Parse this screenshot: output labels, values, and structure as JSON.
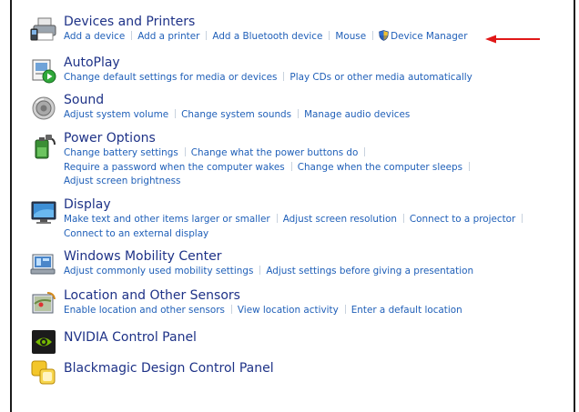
{
  "categories": [
    {
      "title": "Devices and Printers",
      "icon": "devices-printers-icon",
      "links": [
        [
          "Add a device",
          "Add a printer",
          "Add a Bluetooth device",
          "Mouse",
          "Device Manager"
        ]
      ]
    },
    {
      "title": "AutoPlay",
      "icon": "autoplay-icon",
      "links": [
        [
          "Change default settings for media or devices",
          "Play CDs or other media automatically"
        ]
      ]
    },
    {
      "title": "Sound",
      "icon": "speaker-icon",
      "links": [
        [
          "Adjust system volume",
          "Change system sounds",
          "Manage audio devices"
        ]
      ]
    },
    {
      "title": "Power Options",
      "icon": "battery-plug-icon",
      "links": [
        [
          "Change battery settings",
          "Change what the power buttons do"
        ],
        [
          "Require a password when the computer wakes",
          "Change when the computer sleeps"
        ],
        [
          "Adjust screen brightness"
        ]
      ]
    },
    {
      "title": "Display",
      "icon": "monitor-icon",
      "links": [
        [
          "Make text and other items larger or smaller",
          "Adjust screen resolution",
          "Connect to a projector"
        ],
        [
          "Connect to an external display"
        ]
      ]
    },
    {
      "title": "Windows Mobility Center",
      "icon": "mobility-center-icon",
      "links": [
        [
          "Adjust commonly used mobility settings",
          "Adjust settings before giving a presentation"
        ]
      ]
    },
    {
      "title": "Location and Other Sensors",
      "icon": "sensors-icon",
      "links": [
        [
          "Enable location and other sensors",
          "View location activity",
          "Enter a default location"
        ]
      ]
    },
    {
      "title": "NVIDIA Control Panel",
      "icon": "nvidia-icon",
      "links": []
    },
    {
      "title": "Blackmagic Design Control Panel",
      "icon": "blackmagic-icon",
      "links": []
    }
  ],
  "colors": {
    "title": "#1e3287",
    "link": "#1f5fb8",
    "arrow": "#e01818"
  }
}
